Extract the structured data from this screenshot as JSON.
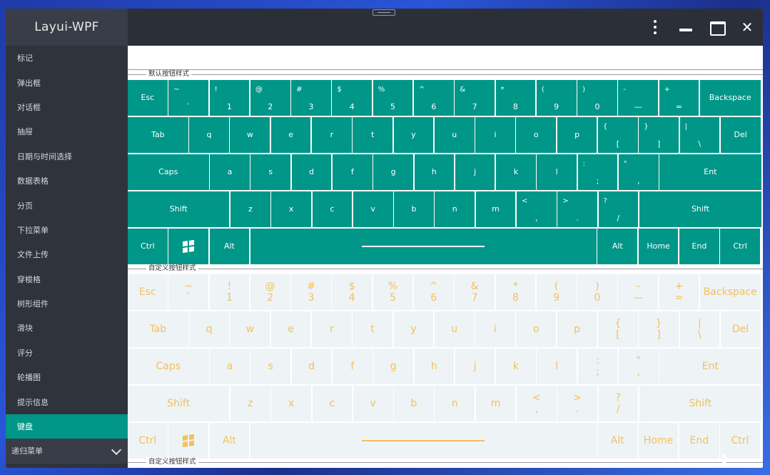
{
  "app": {
    "title": "Layui-WPF"
  },
  "sidebar": {
    "items": [
      {
        "label": "标记"
      },
      {
        "label": "弹出框"
      },
      {
        "label": "对话框"
      },
      {
        "label": "抽屉"
      },
      {
        "label": "日期与时间选择"
      },
      {
        "label": "数据表格"
      },
      {
        "label": "分页"
      },
      {
        "label": "下拉菜单"
      },
      {
        "label": "文件上传"
      },
      {
        "label": "穿梭格"
      },
      {
        "label": "树形组件"
      },
      {
        "label": "滑块"
      },
      {
        "label": "评分"
      },
      {
        "label": "轮播图"
      },
      {
        "label": "提示信息"
      },
      {
        "label": "键盘"
      }
    ],
    "active": "键盘",
    "group": {
      "label": "递归菜单"
    }
  },
  "sections": {
    "default_title": "默认按钮样式",
    "custom_title": "自定义按钮样式",
    "custom_title_2": "自定义按钮样式"
  },
  "keyboard": {
    "row1": [
      {
        "label": "Esc"
      },
      {
        "top": "~",
        "bottom": "`"
      },
      {
        "top": "!",
        "bottom": "1"
      },
      {
        "top": "@",
        "bottom": "2"
      },
      {
        "top": "#",
        "bottom": "3"
      },
      {
        "top": "$",
        "bottom": "4"
      },
      {
        "top": "%",
        "bottom": "5"
      },
      {
        "top": "^",
        "bottom": "6"
      },
      {
        "top": "&",
        "bottom": "7"
      },
      {
        "top": "*",
        "bottom": "8"
      },
      {
        "top": "(",
        "bottom": "9"
      },
      {
        "top": ")",
        "bottom": "0"
      },
      {
        "top": "-",
        "bottom": "—"
      },
      {
        "top": "+",
        "bottom": "="
      },
      {
        "label": "Backspace"
      }
    ],
    "row2": [
      {
        "label": "Tab"
      },
      {
        "label": "q"
      },
      {
        "label": "w"
      },
      {
        "label": "e"
      },
      {
        "label": "r"
      },
      {
        "label": "t"
      },
      {
        "label": "y"
      },
      {
        "label": "u"
      },
      {
        "label": "i"
      },
      {
        "label": "o"
      },
      {
        "label": "p"
      },
      {
        "top": "{",
        "bottom": "["
      },
      {
        "top": "}",
        "bottom": "]"
      },
      {
        "top": "|",
        "bottom": "\\"
      },
      {
        "label": "Del"
      }
    ],
    "row3": [
      {
        "label": "Caps"
      },
      {
        "label": "a"
      },
      {
        "label": "s"
      },
      {
        "label": "d"
      },
      {
        "label": "f"
      },
      {
        "label": "g"
      },
      {
        "label": "h"
      },
      {
        "label": "j"
      },
      {
        "label": "k"
      },
      {
        "label": "l"
      },
      {
        "top": ":",
        "bottom": ";"
      },
      {
        "top": "\"",
        "bottom": ","
      },
      {
        "label": "Ent"
      }
    ],
    "row4": [
      {
        "label": "Shift"
      },
      {
        "label": "z"
      },
      {
        "label": "x"
      },
      {
        "label": "c"
      },
      {
        "label": "v"
      },
      {
        "label": "b"
      },
      {
        "label": "n"
      },
      {
        "label": "m"
      },
      {
        "top": "<",
        "bottom": ","
      },
      {
        "top": ">",
        "bottom": "."
      },
      {
        "top": "?",
        "bottom": "/"
      },
      {
        "label": "Shift"
      }
    ],
    "row5": [
      {
        "label": "Ctrl"
      },
      {
        "icon": "windows-icon"
      },
      {
        "label": "Alt"
      },
      {
        "icon": "space-icon"
      },
      {
        "label": "Alt"
      },
      {
        "label": "Home"
      },
      {
        "label": "End"
      },
      {
        "label": "Ctrl"
      }
    ]
  },
  "colors": {
    "default_key_bg": "#009688",
    "custom_key_bg": "#eef3f6",
    "custom_key_text": "#f3c15a",
    "sidebar_bg": "#2e333c",
    "active_item": "#009688"
  }
}
